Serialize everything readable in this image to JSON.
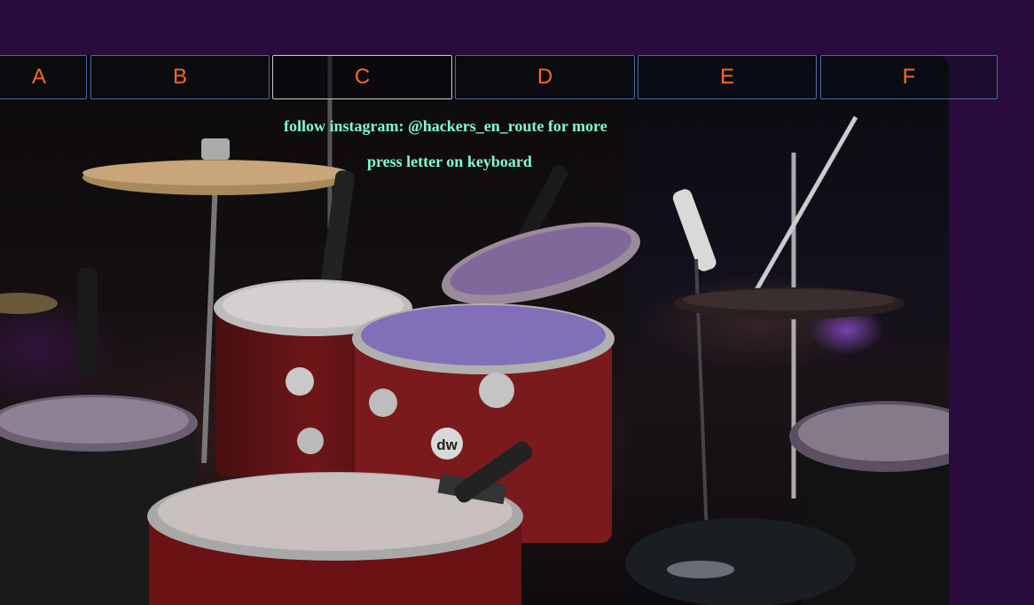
{
  "keys": [
    {
      "label": "A",
      "active": false
    },
    {
      "label": "B",
      "active": false
    },
    {
      "label": "C",
      "active": true
    },
    {
      "label": "D",
      "active": false
    },
    {
      "label": "E",
      "active": false
    },
    {
      "label": "F",
      "active": false
    }
  ],
  "messages": {
    "follow": "follow instagram: @hackers_en_route for more",
    "instruction": "press letter on keyboard"
  },
  "drum_logo": "dw",
  "colors": {
    "page_background": "#2a0b3e",
    "key_text": "#ff6a1a",
    "key_border": "#4a6aa0",
    "message_text": "#7dffcf"
  }
}
